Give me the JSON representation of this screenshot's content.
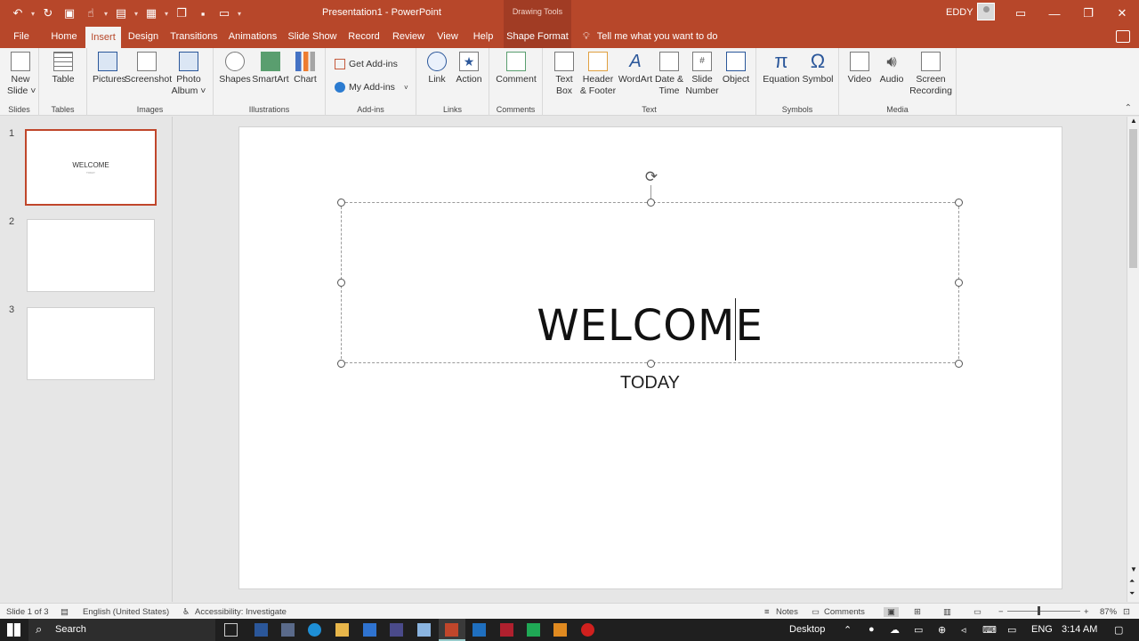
{
  "window": {
    "title": "Presentation1  -  PowerPoint",
    "context_tab": "Drawing Tools",
    "user": "EDDY"
  },
  "tabs": [
    "File",
    "Home",
    "Insert",
    "Design",
    "Transitions",
    "Animations",
    "Slide Show",
    "Record",
    "Review",
    "View",
    "Help",
    "Shape Format"
  ],
  "active_tab": "Insert",
  "tell_me": "Tell me what you want to do",
  "ribbon": {
    "groups": {
      "slides": "Slides",
      "tables": "Tables",
      "images": "Images",
      "illustrations": "Illustrations",
      "addins": "Add-ins",
      "links": "Links",
      "comments": "Comments",
      "text": "Text",
      "symbols": "Symbols",
      "media": "Media"
    },
    "buttons": {
      "new_slide": "New\nSlide ˅",
      "table": "Table",
      "pictures": "Pictures",
      "screenshot": "Screenshot",
      "photo_album": "Photo\nAlbum ˅",
      "shapes": "Shapes",
      "smartart": "SmartArt",
      "chart": "Chart",
      "get_addins": "Get Add-ins",
      "my_addins": "My Add-ins",
      "link": "Link",
      "action": "Action",
      "comment": "Comment",
      "text_box": "Text\nBox",
      "header_footer": "Header\n& Footer",
      "wordart": "WordArt",
      "date_time": "Date &\nTime",
      "slide_number": "Slide\nNumber",
      "object": "Object",
      "equation": "Equation",
      "symbol": "Symbol",
      "video": "Video",
      "audio": "Audio",
      "screen_recording": "Screen\nRecording"
    }
  },
  "thumbnails": [
    {
      "num": "1",
      "title": "WELCOME",
      "sub": "TODAY"
    },
    {
      "num": "2",
      "title": "",
      "sub": ""
    },
    {
      "num": "3",
      "title": "",
      "sub": ""
    }
  ],
  "slide": {
    "title": "WELCOME",
    "subtitle": "TODAY"
  },
  "status": {
    "slide_of": "Slide 1 of 3",
    "language": "English (United States)",
    "accessibility": "Accessibility: Investigate",
    "notes": "Notes",
    "comments": "Comments",
    "zoom": "87%"
  },
  "taskbar": {
    "search": "Search",
    "desktop": "Desktop",
    "lang": "ENG",
    "time": "3:14 AM"
  },
  "colors": {
    "accent": "#b7472a",
    "selected_thumb": "#c0462b"
  }
}
